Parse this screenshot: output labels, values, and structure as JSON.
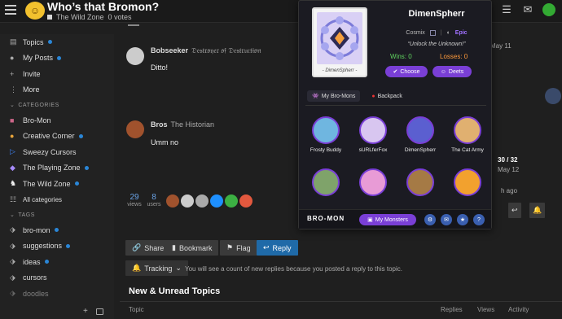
{
  "header": {
    "title": "Who’s that Bromon?",
    "category": "The Wild Zone",
    "votes": "0 votes"
  },
  "sidebar": {
    "items": [
      {
        "label": "Topics",
        "icon": "stack-icon",
        "dot": true
      },
      {
        "label": "My Posts",
        "icon": "user-icon",
        "dot": true
      },
      {
        "label": "Invite",
        "icon": "user-plus-icon",
        "dot": false
      },
      {
        "label": "More",
        "icon": "more-icon",
        "dot": false
      }
    ],
    "categories_header": "CATEGORIES",
    "categories": [
      {
        "label": "Bro-Mon",
        "icon": "bromon-icon",
        "dot": false
      },
      {
        "label": "Creative Corner",
        "icon": "palette-icon",
        "dot": true
      },
      {
        "label": "Sweezy Cursors",
        "icon": "cursor-icon",
        "dot": false
      },
      {
        "label": "The Playing Zone",
        "icon": "gamepad-icon",
        "dot": true
      },
      {
        "label": "The Wild Zone",
        "icon": "wild-icon",
        "dot": true
      }
    ],
    "all_categories": "All categories",
    "tags_header": "TAGS",
    "tags": [
      {
        "label": "bro-mon",
        "dot": true
      },
      {
        "label": "suggestions",
        "dot": true
      },
      {
        "label": "ideas",
        "dot": true
      },
      {
        "label": "cursors",
        "dot": false
      },
      {
        "label": "doodles",
        "dot": false
      }
    ]
  },
  "posts": [
    {
      "author": "Bobseeker",
      "role": "𝔇𝔢𝔰𝔱𝔯𝔬𝔶𝔢𝔯 𝔬𝔣 𝔇𝔢𝔰𝔱𝔯𝔲𝔠𝔱𝔦𝔬𝔫",
      "text": "Ditto!"
    },
    {
      "author": "Bros",
      "role": "The Historian",
      "text": "Umm no"
    }
  ],
  "stats": {
    "views": "29",
    "views_label": "views",
    "users": "8",
    "users_label": "users"
  },
  "actions": {
    "share": "Share",
    "bookmark": "Bookmark",
    "flag": "Flag",
    "reply": "Reply"
  },
  "tracking": {
    "label": "Tracking",
    "text": "You will see a count of new replies because you posted a reply to this topic."
  },
  "new_unread": "New & Unread Topics",
  "topic_cols": {
    "topic": "Topic",
    "replies": "Replies",
    "views": "Views",
    "activity": "Activity"
  },
  "timeline": {
    "date1": "May 11",
    "progress": "30 / 32",
    "date2": "May 12",
    "ago": "h ago"
  },
  "overlay": {
    "card_name": "- DimenSpherr -",
    "name": "DimenSpherr",
    "type": "Cosmix",
    "rarity": "Epic",
    "quote": "“Unlock the Unknown!”",
    "wins": "Wins: 0",
    "losses": "Losses: 0",
    "choose": "Choose",
    "deets": "Deets",
    "tab_mine": "My Bro-Mons",
    "tab_backpack": "Backpack",
    "monsters": [
      {
        "name": "Frosty Buddy",
        "color": "#6fb6e0"
      },
      {
        "name": "sURLferFox",
        "color": "#d8c6f0"
      },
      {
        "name": "DimenSpherr",
        "color": "#5b5fd0"
      },
      {
        "name": "The Cat Army",
        "color": "#e0b070"
      },
      {
        "name": "",
        "color": "#7fa36a"
      },
      {
        "name": "",
        "color": "#e89bd6"
      },
      {
        "name": "",
        "color": "#a57a45"
      },
      {
        "name": "",
        "color": "#f2a12e"
      }
    ],
    "brand": "BRO-MON",
    "my_monsters": "My Monsters"
  }
}
